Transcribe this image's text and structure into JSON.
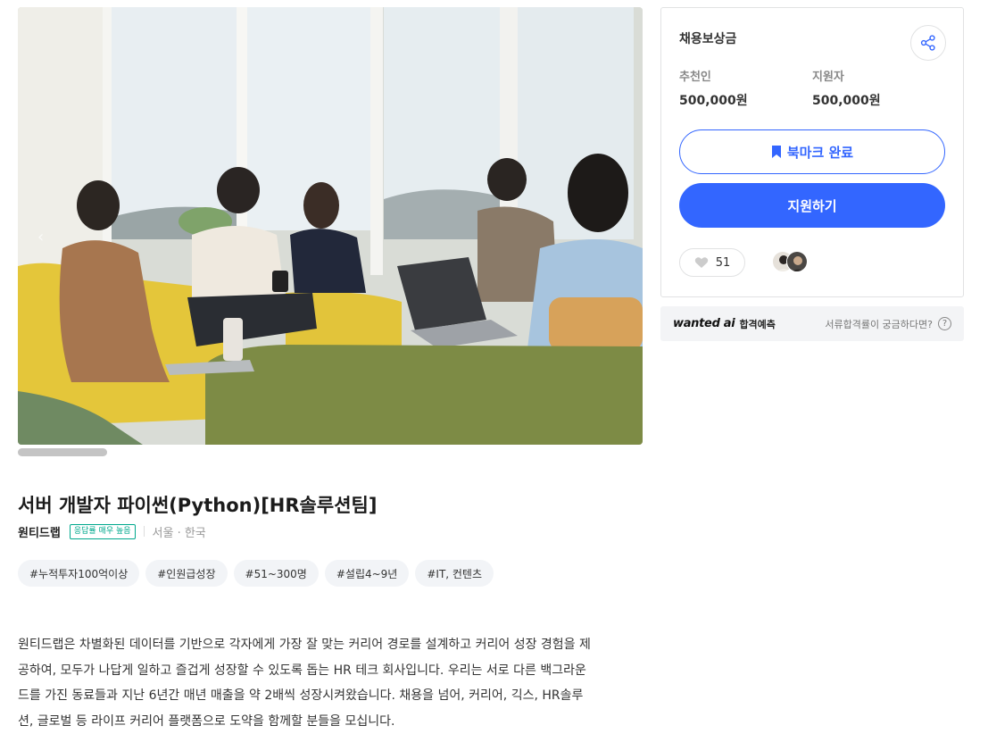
{
  "hero": {
    "alt_icon": "image-left-arrow-icon"
  },
  "job": {
    "title": "서버 개발자 파이썬(Python)[HR솔루션팀]",
    "company": "원티드랩",
    "response_badge": "응답률 매우 높음",
    "location": "서울 · 한국",
    "tags": [
      "#누적투자100억이상",
      "#인원급성장",
      "#51~300명",
      "#설립4~9년",
      "#IT, 컨텐츠"
    ],
    "description_lines": [
      "원티드랩은 차별화된 데이터를 기반으로 각자에게 가장 잘 맞는 커리어 경로를 설계하고 커리어 성장 경험을 제",
      "공하여, 모두가 나답게 일하고 즐겁게 성장할 수 있도록 돕는 HR 테크 회사입니다.  우리는 서로 다른 백그라운",
      "드를 가진 동료들과 지난 6년간 매년 매출을 약 2배씩 성장시켜왔습니다. 채용을 넘어, 커리어, 긱스, HR솔루",
      "션, 글로벌 등  라이프 커리어 플랫폼으로 도약을 함께할 분들을 모십니다."
    ]
  },
  "reward": {
    "title": "채용보상금",
    "recommender_label": "추천인",
    "recommender_value": "500,000원",
    "applicant_label": "지원자",
    "applicant_value": "500,000원",
    "bookmark_label": "북마크 완료",
    "apply_label": "지원하기",
    "like_count": "51"
  },
  "ai": {
    "logo": "wanted ai",
    "label": "합격예측",
    "question": "서류합격률이 궁금하다면?",
    "help_glyph": "?"
  },
  "colors": {
    "primary": "#3366ff",
    "badge": "#00a88d"
  }
}
